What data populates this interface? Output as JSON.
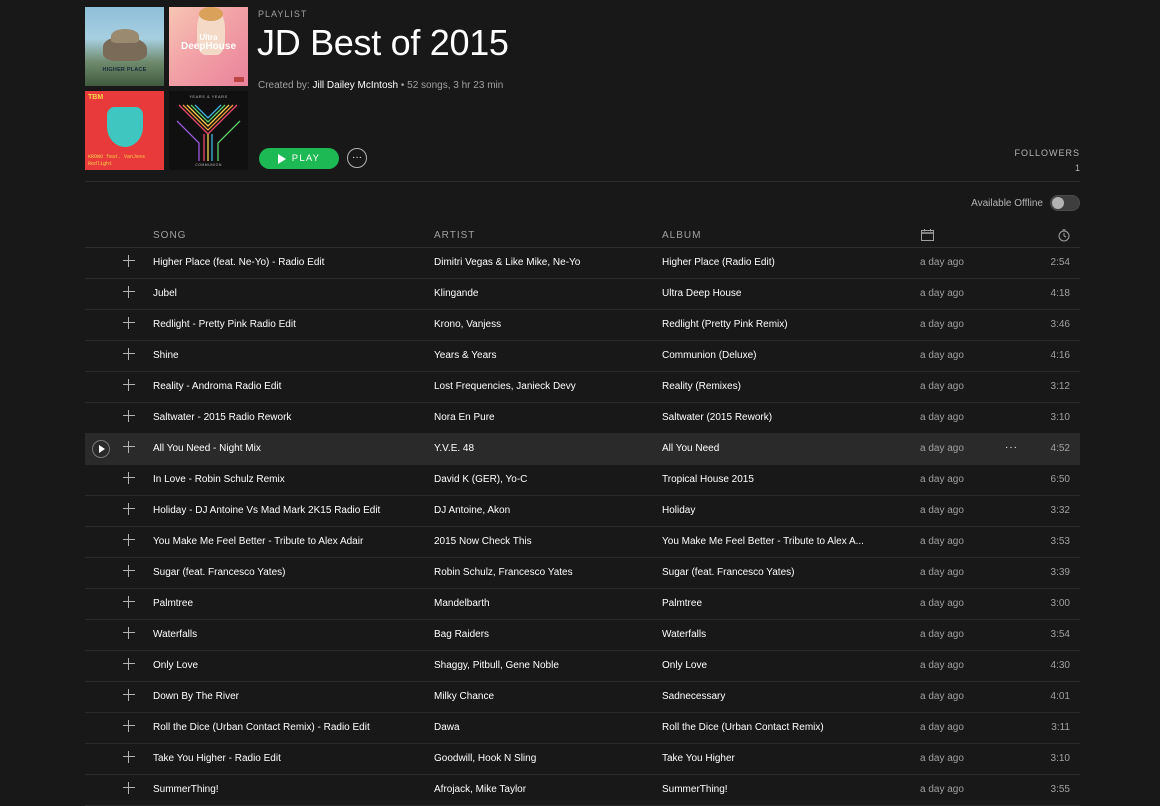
{
  "header": {
    "type_label": "PLAYLIST",
    "title": "JD Best of 2015",
    "created_by_prefix": "Created by: ",
    "created_by_name": "Jill Dailey McIntosh",
    "summary": " • 52 songs, 3 hr 23 min",
    "play_label": "PLAY",
    "more_label": "···",
    "followers_label": "FOLLOWERS",
    "followers_count": "1",
    "offline_label": "Available Offline"
  },
  "art": {
    "t1_title": "HIGHER PLACE",
    "t2_line1": "Ultra",
    "t2_line2": "DeepHouse",
    "t3_logo": "TBM",
    "t3_line1": "KRONO feat. VanJess",
    "t3_line2": "Redlight",
    "t4_top": "YEARS & YEARS",
    "t4_bottom": "COMMUNION"
  },
  "columns": {
    "song": "SONG",
    "artist": "ARTIST",
    "album": "ALBUM"
  },
  "tracks": [
    {
      "song": "Higher Place (feat. Ne-Yo) - Radio Edit",
      "artist": "Dimitri Vegas & Like Mike, Ne-Yo",
      "album": "Higher Place (Radio Edit)",
      "added": "a day ago",
      "time": "2:54"
    },
    {
      "song": "Jubel",
      "artist": "Klingande",
      "album": "Ultra Deep House",
      "added": "a day ago",
      "time": "4:18"
    },
    {
      "song": "Redlight - Pretty Pink Radio Edit",
      "artist": "Krono, Vanjess",
      "album": "Redlight (Pretty Pink Remix)",
      "added": "a day ago",
      "time": "3:46"
    },
    {
      "song": "Shine",
      "artist": "Years & Years",
      "album": "Communion (Deluxe)",
      "added": "a day ago",
      "time": "4:16"
    },
    {
      "song": "Reality - Androma Radio Edit",
      "artist": "Lost Frequencies, Janieck Devy",
      "album": "Reality (Remixes)",
      "added": "a day ago",
      "time": "3:12"
    },
    {
      "song": "Saltwater - 2015 Radio Rework",
      "artist": "Nora En Pure",
      "album": "Saltwater (2015 Rework)",
      "added": "a day ago",
      "time": "3:10"
    },
    {
      "song": "All You Need - Night Mix",
      "artist": "Y.V.E. 48",
      "album": "All You Need",
      "added": "a day ago",
      "time": "4:52"
    },
    {
      "song": "In Love - Robin Schulz Remix",
      "artist": "David K (GER), Yo-C",
      "album": "Tropical House 2015",
      "added": "a day ago",
      "time": "6:50"
    },
    {
      "song": "Holiday - DJ Antoine Vs Mad Mark 2K15 Radio Edit",
      "artist": "DJ Antoine, Akon",
      "album": "Holiday",
      "added": "a day ago",
      "time": "3:32"
    },
    {
      "song": "You Make Me Feel Better - Tribute to Alex Adair",
      "artist": "2015 Now Check This",
      "album": "You Make Me Feel Better - Tribute to Alex A...",
      "added": "a day ago",
      "time": "3:53"
    },
    {
      "song": "Sugar (feat. Francesco Yates)",
      "artist": "Robin Schulz, Francesco Yates",
      "album": "Sugar (feat. Francesco Yates)",
      "added": "a day ago",
      "time": "3:39"
    },
    {
      "song": "Palmtree",
      "artist": "Mandelbarth",
      "album": "Palmtree",
      "added": "a day ago",
      "time": "3:00"
    },
    {
      "song": "Waterfalls",
      "artist": "Bag Raiders",
      "album": "Waterfalls",
      "added": "a day ago",
      "time": "3:54"
    },
    {
      "song": "Only Love",
      "artist": "Shaggy, Pitbull, Gene Noble",
      "album": "Only Love",
      "added": "a day ago",
      "time": "4:30"
    },
    {
      "song": "Down By The River",
      "artist": "Milky Chance",
      "album": "Sadnecessary",
      "added": "a day ago",
      "time": "4:01"
    },
    {
      "song": "Roll the Dice (Urban Contact Remix) - Radio Edit",
      "artist": "Dawa",
      "album": "Roll the Dice (Urban Contact Remix)",
      "added": "a day ago",
      "time": "3:11"
    },
    {
      "song": "Take You Higher - Radio Edit",
      "artist": "Goodwill, Hook N Sling",
      "album": "Take You Higher",
      "added": "a day ago",
      "time": "3:10"
    },
    {
      "song": "SummerThing!",
      "artist": "Afrojack, Mike Taylor",
      "album": "SummerThing!",
      "added": "a day ago",
      "time": "3:55"
    }
  ],
  "active_row_index": 6,
  "active_row_more": "···",
  "colors": {
    "accent": "#1db954",
    "background": "#181818",
    "row_hover": "#2a2a2a"
  }
}
